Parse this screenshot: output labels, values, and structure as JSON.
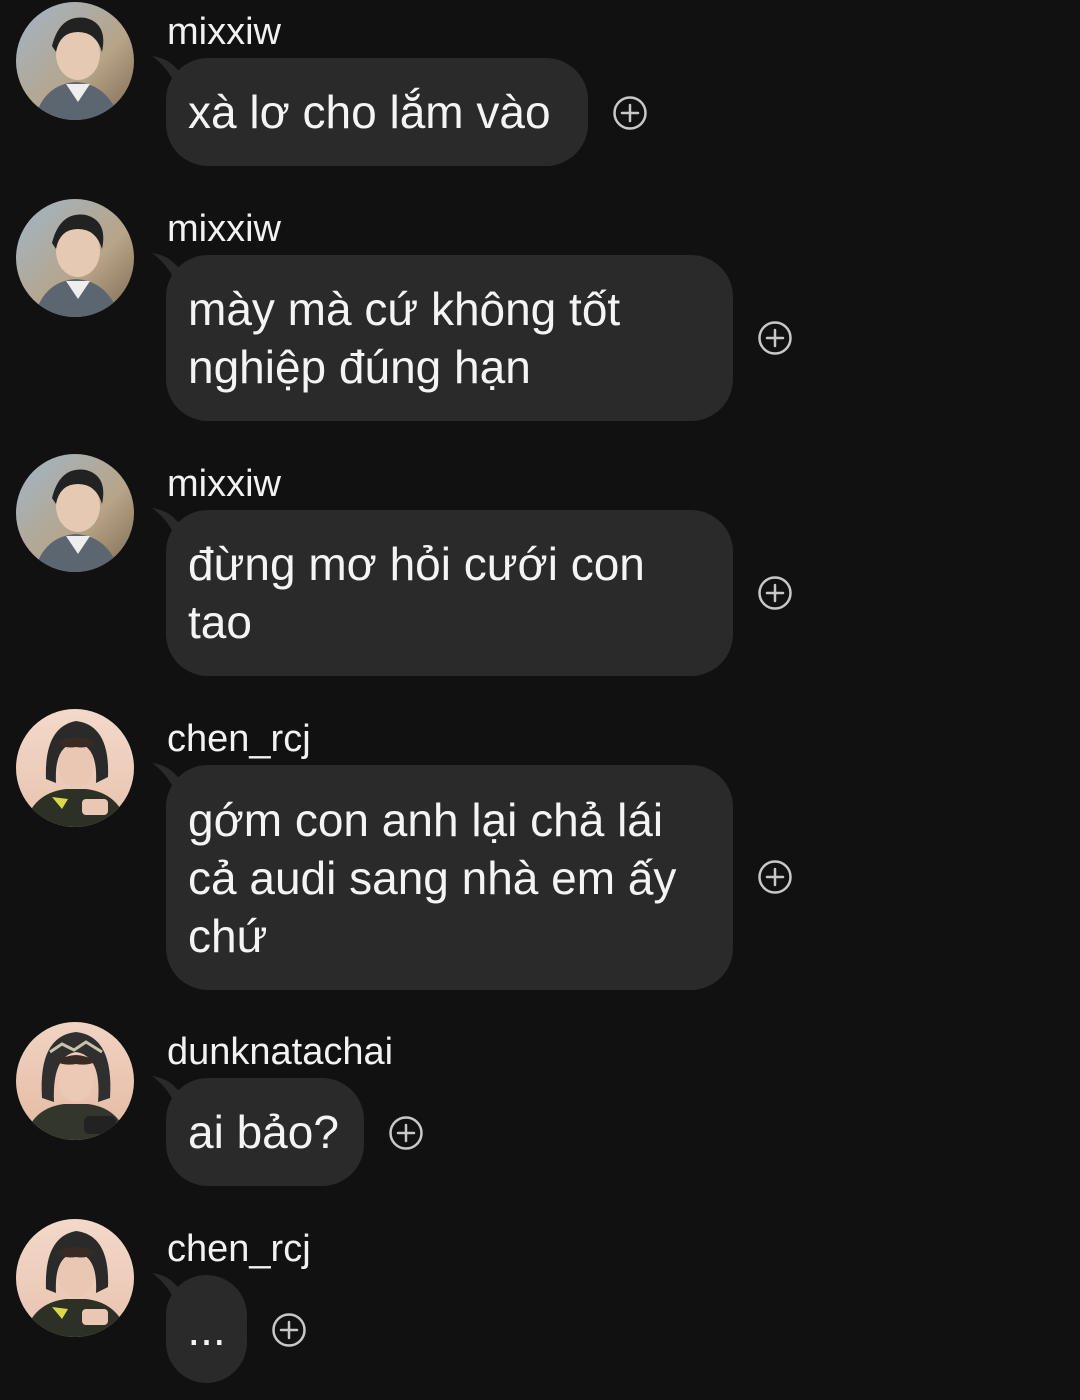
{
  "colors": {
    "background": "#111111",
    "bubble": "#2a2a2a",
    "text": "#f4f4f4",
    "icon": "#c8c8c8"
  },
  "messages": [
    {
      "username": "mixxiw",
      "avatar": "avatar-mixxiw",
      "text": "xà lơ cho lắm vào",
      "icon": "add-reaction-icon"
    },
    {
      "username": "mixxiw",
      "avatar": "avatar-mixxiw",
      "text": "mày mà cứ không tốt\nnghiệp đúng hạn",
      "icon": "add-reaction-icon"
    },
    {
      "username": "mixxiw",
      "avatar": "avatar-mixxiw",
      "text": "đừng mơ hỏi cưới con\ntao",
      "icon": "add-reaction-icon"
    },
    {
      "username": "chen_rcj",
      "avatar": "avatar-chen-rcj",
      "text": "gớm con anh lại chả lái\ncả audi sang nhà em ấy\nchứ",
      "icon": "add-reaction-icon"
    },
    {
      "username": "dunknatachai",
      "avatar": "avatar-dunknatachai",
      "text": "ai bảo?",
      "icon": "add-reaction-icon"
    },
    {
      "username": "chen_rcj",
      "avatar": "avatar-chen-rcj",
      "text": "...",
      "icon": "add-reaction-icon"
    }
  ]
}
